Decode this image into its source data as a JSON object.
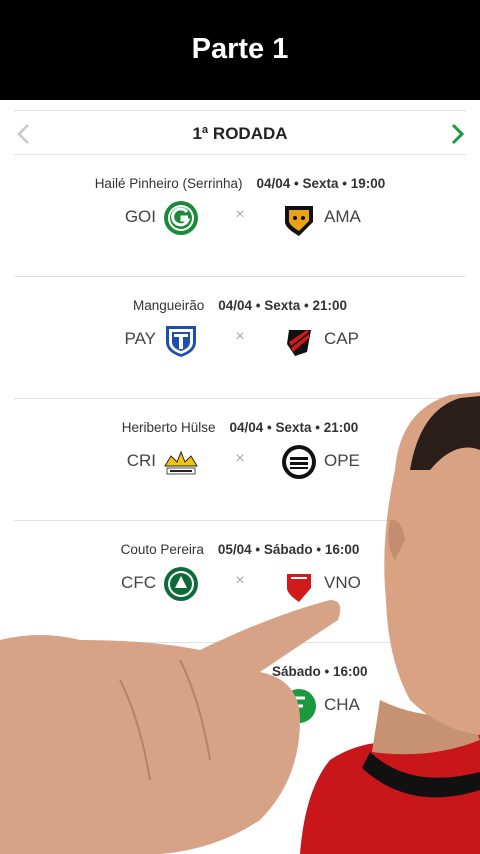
{
  "header": {
    "title": "Parte 1"
  },
  "round": {
    "title": "1ª RODADA"
  },
  "matches": [
    {
      "venue": "Hailé Pinheiro (Serrinha)",
      "when": "04/04 • Sexta • 19:00",
      "home": "GOI",
      "away": "AMA"
    },
    {
      "venue": "Mangueirão",
      "when": "04/04 • Sexta • 21:00",
      "home": "PAY",
      "away": "CAP"
    },
    {
      "venue": "Heriberto Hülse",
      "when": "04/04 • Sexta • 21:00",
      "home": "CRI",
      "away": "OPE"
    },
    {
      "venue": "Couto Pereira",
      "when": "05/04 • Sábado • 16:00",
      "home": "CFC",
      "away": "VNO"
    },
    {
      "venue": "",
      "when": "Sábado • 16:00",
      "home": "",
      "away": "CHA"
    }
  ],
  "vs_symbol": "×",
  "colors": {
    "accent_green": "#1a9a3c",
    "nav_disabled": "#c8c8c8",
    "shirt_red": "#d11a1a"
  },
  "icons": [
    "chevron-left-icon",
    "chevron-right-icon",
    "goias-crest-icon",
    "amazonas-crest-icon",
    "paysandu-crest-icon",
    "athletico-crest-icon",
    "criciuma-crest-icon",
    "operario-crest-icon",
    "coritiba-crest-icon",
    "vila-nova-crest-icon",
    "chapecoense-crest-icon"
  ]
}
